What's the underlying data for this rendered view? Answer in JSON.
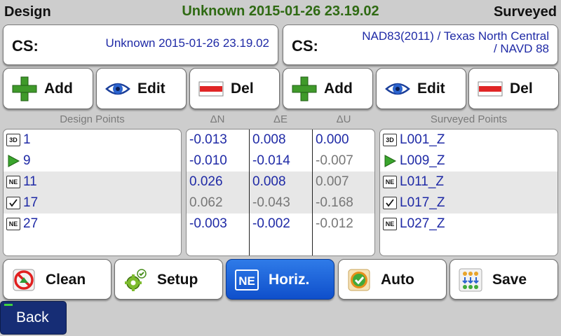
{
  "header": {
    "left": "Design",
    "center": "Unknown 2015-01-26 23.19.02",
    "right": "Surveyed"
  },
  "cs": {
    "left": {
      "label": "CS:",
      "value": "Unknown 2015-01-26 23.19.02"
    },
    "right": {
      "label": "CS:",
      "value_line1": "NAD83(2011) / Texas North Central",
      "value_line2": "/ NAVD 88"
    }
  },
  "buttons": {
    "add": "Add",
    "edit": "Edit",
    "del": "Del"
  },
  "columns": {
    "design_points": "Design Points",
    "dn": "ΔN",
    "de": "ΔE",
    "du": "ΔU",
    "surveyed_points": "Surveyed Points"
  },
  "design_points": [
    {
      "icon": "3D",
      "name": "1"
    },
    {
      "icon": "arrow",
      "name": "9"
    },
    {
      "icon": "NE",
      "name": "11"
    },
    {
      "icon": "check",
      "name": "17"
    },
    {
      "icon": "NE",
      "name": "27"
    }
  ],
  "deltas": [
    {
      "dn": "-0.013",
      "de": "0.008",
      "du": "0.000",
      "colors": [
        "blue",
        "blue",
        "blue"
      ]
    },
    {
      "dn": "-0.010",
      "de": "-0.014",
      "du": "-0.007",
      "colors": [
        "blue",
        "blue",
        "gray"
      ]
    },
    {
      "dn": "0.026",
      "de": "0.008",
      "du": "0.007",
      "colors": [
        "blue",
        "blue",
        "gray"
      ]
    },
    {
      "dn": "0.062",
      "de": "-0.043",
      "du": "-0.168",
      "colors": [
        "gray",
        "gray",
        "gray"
      ]
    },
    {
      "dn": "-0.003",
      "de": "-0.002",
      "du": "-0.012",
      "colors": [
        "blue",
        "blue",
        "gray"
      ]
    }
  ],
  "surveyed_points": [
    {
      "icon": "3D",
      "name": "L001_Z"
    },
    {
      "icon": "arrow",
      "name": "L009_Z"
    },
    {
      "icon": "NE",
      "name": "L011_Z"
    },
    {
      "icon": "check",
      "name": "L017_Z"
    },
    {
      "icon": "NE",
      "name": "L027_Z"
    }
  ],
  "bottom": {
    "clean": "Clean",
    "setup": "Setup",
    "horiz": "Horiz.",
    "horiz_icon_text": "NE",
    "auto": "Auto",
    "save": "Save"
  },
  "back": "Back",
  "colors": {
    "title_green": "#2f6a13",
    "value_blue": "#1f2aa6",
    "muted_gray": "#777777",
    "active_blue": "#1f63d8",
    "back_navy": "#162d75"
  }
}
